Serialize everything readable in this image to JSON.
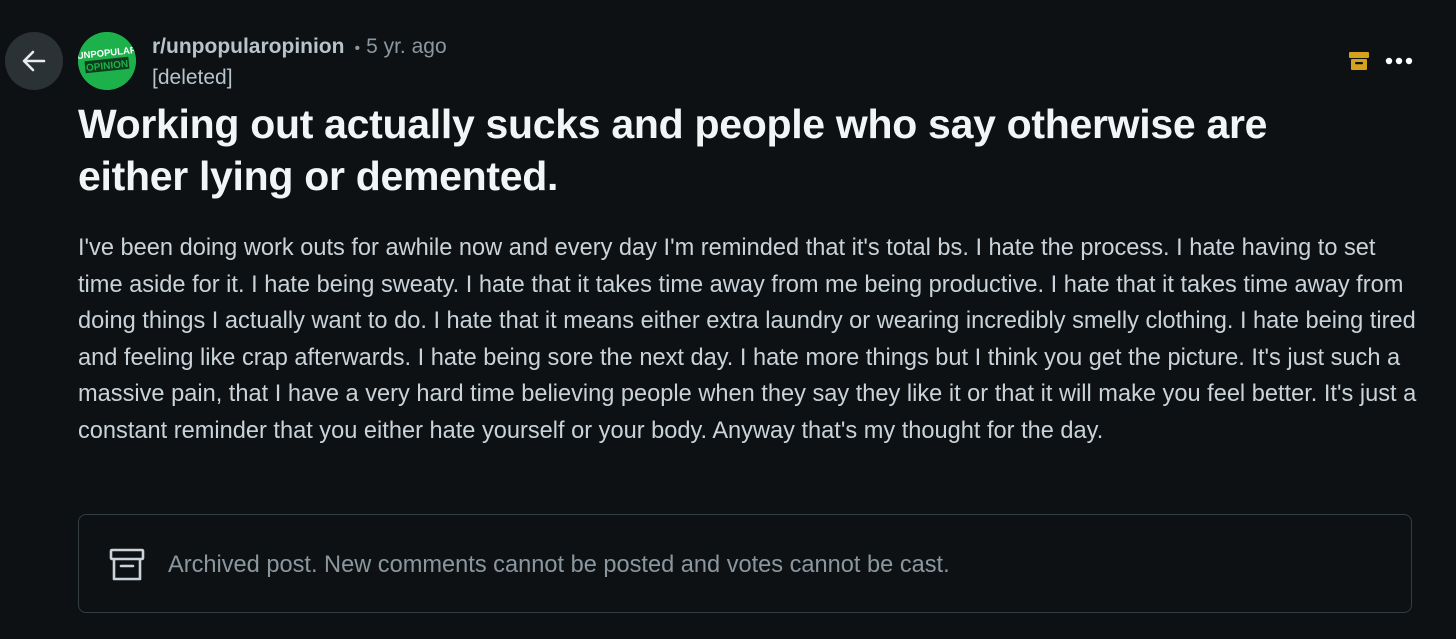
{
  "post": {
    "subreddit": "r/unpopularopinion",
    "separator": "•",
    "age": "5 yr. ago",
    "author": "[deleted]",
    "avatar_text_line1": "UNPOPULAR",
    "avatar_text_line2": "OPINION",
    "title": "Working out actually sucks and people who say otherwise are either lying or demented.",
    "body": "I've been doing work outs for awhile now and every day I'm reminded that it's total bs. I hate the process. I hate having to set time aside for it. I hate being sweaty. I hate that it takes time away from me being productive. I hate that it takes time away from doing things I actually want to do. I hate that it means either extra laundry or wearing incredibly smelly clothing. I hate being tired and feeling like crap afterwards. I hate being sore the next day. I hate more things but I think you get the picture. It's just such a massive pain, that I have a very hard time believing people when they say they like it or that it will make you feel better. It's just a constant reminder that you either hate yourself or your body. Anyway that's my thought for the day."
  },
  "notice": {
    "text": "Archived post. New comments cannot be posted and votes cannot be cast."
  },
  "icons": {
    "back": "arrow-left-icon",
    "archive_badge": "archive-box-icon",
    "more": "more-horizontal-icon",
    "notice": "archive-box-outline-icon"
  },
  "colors": {
    "background": "#0e1113",
    "avatar_green": "#1db14b",
    "archive_badge": "#d6a21e",
    "title": "#f2f4f5",
    "body_text": "#c9d3d9",
    "muted": "#8a979e"
  }
}
